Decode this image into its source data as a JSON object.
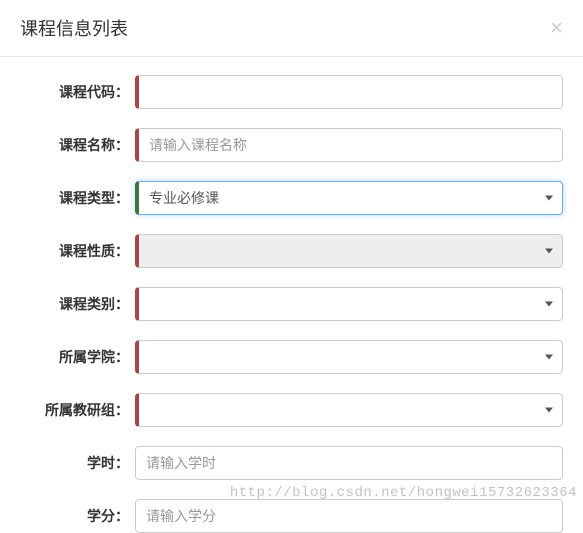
{
  "header": {
    "title": "课程信息列表",
    "close": "×"
  },
  "form": {
    "rows": [
      {
        "label": "课程代码：",
        "type": "text",
        "value": "",
        "placeholder": "",
        "required": true,
        "name": "course-code"
      },
      {
        "label": "课程名称：",
        "type": "text",
        "value": "",
        "placeholder": "请输入课程名称",
        "required": true,
        "name": "course-name"
      },
      {
        "label": "课程类型：",
        "type": "select",
        "value": "专业必修课",
        "required": true,
        "focused": true,
        "name": "course-type"
      },
      {
        "label": "课程性质：",
        "type": "select",
        "value": "",
        "required": true,
        "disabled": true,
        "name": "course-nature"
      },
      {
        "label": "课程类别：",
        "type": "select",
        "value": "",
        "required": true,
        "name": "course-category"
      },
      {
        "label": "所属学院：",
        "type": "select",
        "value": "",
        "required": true,
        "name": "college"
      },
      {
        "label": "所属教研组：",
        "type": "select",
        "value": "",
        "required": true,
        "name": "teaching-group"
      },
      {
        "label": "学时：",
        "type": "text",
        "value": "",
        "placeholder": "请输入学时",
        "required": false,
        "name": "credit-hours"
      },
      {
        "label": "学分：",
        "type": "text",
        "value": "",
        "placeholder": "请输入学分",
        "required": false,
        "name": "credits"
      }
    ]
  },
  "watermark": "http://blog.csdn.net/hongwei15732623364"
}
